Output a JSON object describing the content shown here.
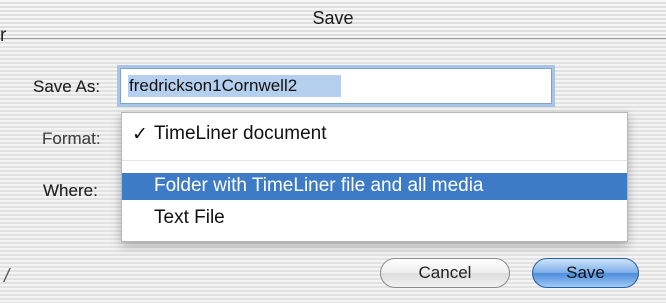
{
  "window": {
    "title": "Save"
  },
  "edge_fragments": {
    "left_glyph": "r",
    "bottom_glyph": "/"
  },
  "form": {
    "save_as_label": "Save As:",
    "filename_value": "fredrickson1Cornwell2",
    "format_label": "Format:",
    "where_label": "Where:"
  },
  "format_menu": {
    "items": [
      {
        "label": "TimeLiner document",
        "checked": true,
        "checkmark": "✓",
        "highlighted": false
      },
      {
        "label": "Folder with TimeLiner file and all media",
        "checked": false,
        "highlighted": true
      },
      {
        "label": "Text File",
        "checked": false,
        "highlighted": false
      }
    ]
  },
  "buttons": {
    "cancel": "Cancel",
    "save": "Save"
  },
  "colors": {
    "highlight": "#3d7bc7",
    "default_button": "#4f8ddb",
    "focus_ring": "#a9c5e6"
  }
}
